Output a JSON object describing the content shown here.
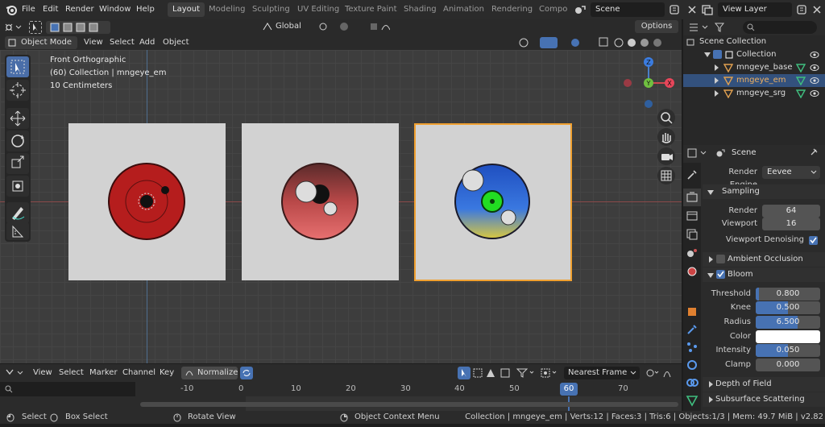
{
  "topbar": {
    "menus": [
      "File",
      "Edit",
      "Render",
      "Window",
      "Help"
    ],
    "workspaces": [
      "Layout",
      "Modeling",
      "Sculpting",
      "UV Editing",
      "Texture Paint",
      "Shading",
      "Animation",
      "Rendering",
      "Compo"
    ],
    "active_workspace": "Layout",
    "scene": "Scene",
    "view_layer": "View Layer"
  },
  "viewport_header": {
    "mode": "Object Mode",
    "menus": [
      "View",
      "Select",
      "Add",
      "Object"
    ],
    "orientation": "Global",
    "options": "Options"
  },
  "viewport": {
    "view_name": "Front Orthographic",
    "collection_info": "(60) Collection | mngeye_em",
    "scale": "10 Centimeters",
    "axes": {
      "z": "Z",
      "y": "Y",
      "x": "X"
    }
  },
  "outliner": {
    "root": "Scene Collection",
    "collection": "Collection",
    "items": [
      {
        "name": "mngeye_base",
        "selected": false
      },
      {
        "name": "mngeye_em",
        "selected": true
      },
      {
        "name": "mngeye_srg",
        "selected": false
      }
    ]
  },
  "properties": {
    "context": "Scene",
    "render_engine_label": "Render Engine",
    "render_engine": "Eevee",
    "sampling": {
      "title": "Sampling",
      "render_label": "Render",
      "render": "64",
      "viewport_label": "Viewport",
      "viewport": "16",
      "denoise_label": "Viewport Denoising",
      "denoise": true
    },
    "ambient_occlusion": {
      "title": "Ambient Occlusion",
      "enabled": false
    },
    "bloom": {
      "title": "Bloom",
      "enabled": true,
      "threshold_label": "Threshold",
      "threshold": "0.800",
      "threshold_frac": 0.05,
      "knee_label": "Knee",
      "knee": "0.500",
      "knee_frac": 0.5,
      "radius_label": "Radius",
      "radius": "6.500",
      "radius_frac": 0.65,
      "color_label": "Color",
      "color": "#ffffff",
      "intensity_label": "Intensity",
      "intensity": "0.050",
      "intensity_frac": 0.5,
      "clamp_label": "Clamp",
      "clamp": "0.000"
    },
    "depth_of_field": "Depth of Field",
    "subsurface": "Subsurface Scattering"
  },
  "timeline": {
    "menus": [
      "View",
      "Select",
      "Marker",
      "Channel",
      "Key"
    ],
    "normalize": "Normalize",
    "interpolation": "Nearest Frame",
    "ticks": [
      "-10",
      "0",
      "10",
      "20",
      "30",
      "40",
      "50",
      "60",
      "70"
    ],
    "current_frame": "60"
  },
  "statusbar": {
    "select": "Select",
    "box_select": "Box Select",
    "rotate_view": "Rotate View",
    "context_menu": "Object Context Menu",
    "stats": "Collection | mngeye_em | Verts:12 | Faces:3 | Tris:6 | Objects:1/3 | Mem: 49.7 MiB | v2.82"
  },
  "colors": {
    "accent": "#4772b3",
    "selection_outline": "#f0a030",
    "header": "#2b2b2b",
    "viewport_bg": "#3d3d3d"
  }
}
